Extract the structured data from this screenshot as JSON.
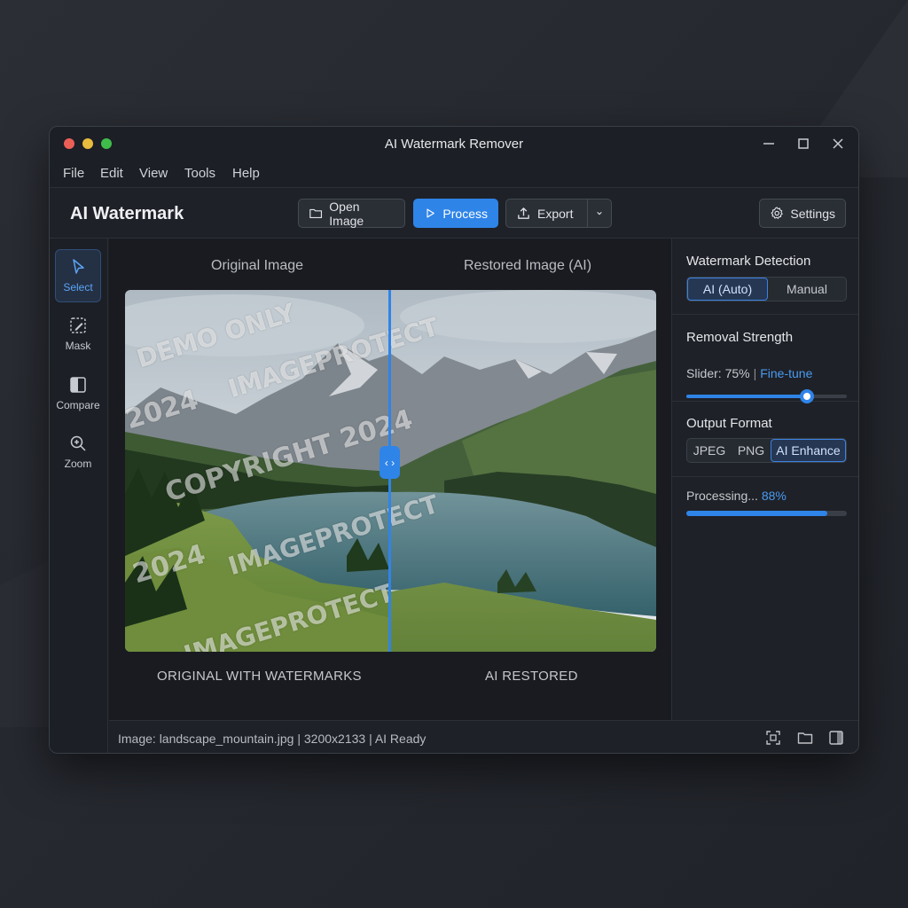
{
  "window": {
    "title": "AI Watermark Remover"
  },
  "menu": [
    "File",
    "Edit",
    "View",
    "Tools",
    "Help"
  ],
  "toolbar": {
    "app_name": "AI Watermark",
    "open_label": "Open Image",
    "process_label": "Process",
    "export_label": "Export",
    "settings_label": "Settings"
  },
  "tools": {
    "select": "Select",
    "mask": "Mask",
    "compare": "Compare",
    "zoom": "Zoom"
  },
  "canvas": {
    "left_title": "Original Image",
    "right_title": "Restored Image (AI)",
    "left_caption": "ORIGINAL WITH WATERMARKS",
    "right_caption": "AI RESTORED",
    "divider_handle": "‹ ›",
    "watermarks": {
      "demo": "DEMO ONLY",
      "protect_1": "IMAGEPROTECT",
      "year_1": "2024",
      "copyright": "COPYRIGHT 2024",
      "protect_2": "IMAGEPROTECT",
      "year_2": "2024",
      "protect_3": "IMAGEPROTECT"
    }
  },
  "panel": {
    "detection": {
      "title": "Watermark Detection",
      "options": [
        "AI (Auto)",
        "Manual"
      ],
      "selected": "AI (Auto)"
    },
    "strength": {
      "title": "Removal Strength",
      "slider_text": "Slider: 75%",
      "separator": "|",
      "finetune_label": "Fine-tune",
      "value_percent": 75
    },
    "format": {
      "title": "Output Format",
      "options": [
        "JPEG",
        "PNG",
        "AI Enhance"
      ],
      "selected": "AI Enhance"
    },
    "progress": {
      "label": "Processing...",
      "percent_text": "88%",
      "value_percent": 88
    }
  },
  "status": {
    "text": "Image: landscape_mountain.jpg | 3200x2133 | AI Ready"
  },
  "colors": {
    "accent": "#2f84e8",
    "window_bg": "#1c1f25",
    "link": "#4a9af0"
  }
}
